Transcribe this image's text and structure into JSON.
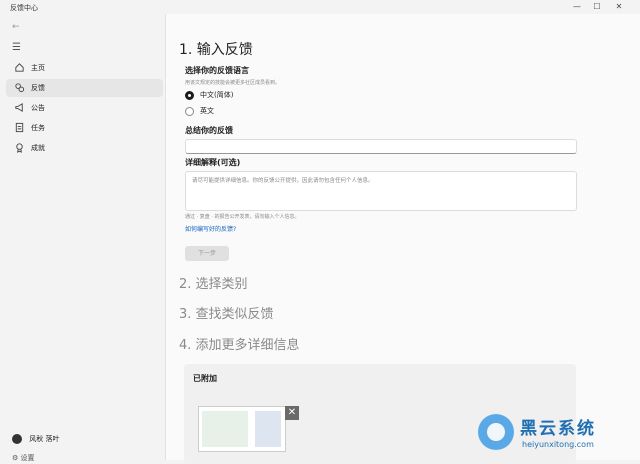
{
  "window": {
    "title": "反馈中心",
    "minimize": "—",
    "maximize": "☐",
    "close": "✕"
  },
  "sidebar": {
    "back": "←",
    "menu": "☰",
    "items": [
      {
        "label": "主页",
        "icon": "home-icon",
        "active": false
      },
      {
        "label": "反馈",
        "icon": "feedback-icon",
        "active": true
      },
      {
        "label": "公告",
        "icon": "megaphone-icon",
        "active": false
      },
      {
        "label": "任务",
        "icon": "task-icon",
        "active": false
      },
      {
        "label": "成就",
        "icon": "achievement-icon",
        "active": false
      }
    ],
    "user_name": "风秋 落叶",
    "settings_label": "设置"
  },
  "main": {
    "step1_title": "1. 输入反馈",
    "language": {
      "title": "选择你的反馈语言",
      "hint": "用该文规定的技能会被更多社区成员看到。",
      "options": [
        {
          "label": "中文(简体)",
          "selected": true
        },
        {
          "label": "英文",
          "selected": false
        }
      ]
    },
    "summary": {
      "title": "总结你的反馈",
      "value": ""
    },
    "details": {
      "title": "详细解释(可选)",
      "placeholder": "请尽可能提供详细信息。你的反馈公开提供，因此请勿包含任何个人信息。",
      "footnote": "通过 · 复盘 · 的报告公开发表，请勿输入个人信息。"
    },
    "help_link": "如何编写好的反馈?",
    "next_button": "下一步",
    "steps": [
      "2. 选择类别",
      "3. 查找类似反馈",
      "4. 添加更多详细信息"
    ],
    "attached": {
      "title": "已附加",
      "remove": "✕"
    }
  },
  "watermark": {
    "name": "黑云系统",
    "site": "heiyunxitong.com"
  }
}
